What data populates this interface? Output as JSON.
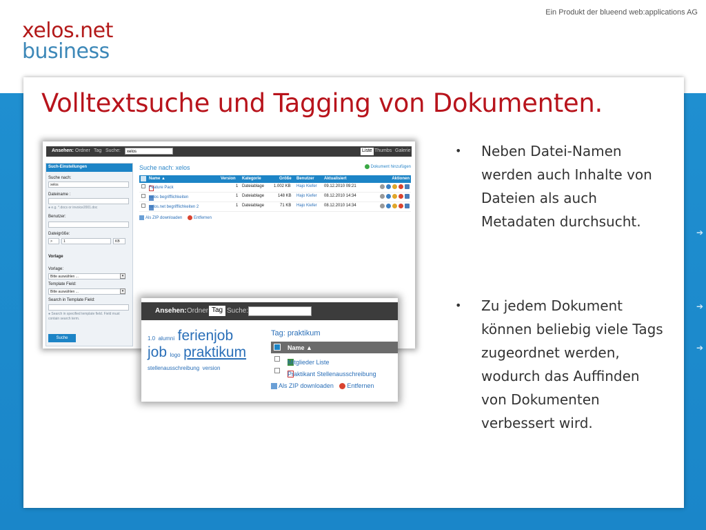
{
  "slide": {
    "tagline": "Ein Produkt der blueend web:applications AG",
    "logo_line1": "xelos.net",
    "logo_line2": "business",
    "title": "Volltextsuche und Tagging von Dokumenten.",
    "bullets": [
      "Neben Datei-Namen werden auch Inhalte von Dateien als auch Metadaten durchsucht.",
      "Zu jedem Dokument können beliebig viele Tags zugeordnet werden, wodurch das Auffinden von Dokumenten verbessert wird."
    ],
    "nav_arrow": "➔"
  },
  "shot1": {
    "toolbar": {
      "view_label": "Ansehen:",
      "folder": "Ordner",
      "tag": "Tag",
      "search_label": "Suche:",
      "search_value": "xelos",
      "list": "Liste",
      "thumbs": "Thumbs",
      "gallery": "Galerie"
    },
    "sidebar": {
      "header": "Such-Einstellungen",
      "search_for_label": "Suche nach:",
      "search_for_value": "xelos",
      "filename_label": "Dateiname :",
      "filename_hint": "e.g. *.docs or invoice2001.doc",
      "user_label": "Benutzer:",
      "filesize_label": "Dateigröße:",
      "filesize_op": ">",
      "filesize_value": "1",
      "filesize_unit": "KB",
      "template_header": "Vorlage",
      "template_label": "Vorlage:",
      "template_value": "Bitte auswählen ...",
      "template_field_label": "Template Field:",
      "template_field_value": "Bitte auswählen ...",
      "search_tf_label": "Search in Template Field:",
      "search_tf_hint": "Search in specified template field. Field must contain search term.",
      "search_button": "Suche"
    },
    "main": {
      "title": "Suche nach: xelos",
      "add_doc": "Dokument hinzufügen",
      "headers": [
        "Name ▲",
        "Version",
        "Kategorie",
        "Größe",
        "Benutzer",
        "Aktualisiert",
        "Aktionen"
      ],
      "rows": [
        {
          "type": "pdf",
          "name": "Feature Pack",
          "version": "1",
          "category": "Dateiablage",
          "size": "1.002 KB",
          "user": "Hajo Kiefer",
          "updated": "09.12.2010 09:21"
        },
        {
          "type": "doc",
          "name": "xelos begrifflichkeiten",
          "version": "1",
          "category": "Dateiablage",
          "size": "148 KB",
          "user": "Hajo Kiefer",
          "updated": "08.12.2010 14:34"
        },
        {
          "type": "doc",
          "name": "xelos.net begrifflichkeiten 2",
          "version": "1",
          "category": "Dateiablage",
          "size": "71 KB",
          "user": "Hajo Kiefer",
          "updated": "08.12.2010 14:34"
        }
      ],
      "zip": "Als ZIP downloaden",
      "remove": "Entfernen"
    }
  },
  "shot2": {
    "toolbar": {
      "view_label": "Ansehen:",
      "folder": "Ordner",
      "tag": "Tag",
      "search_label": "Suche:"
    },
    "cloud": {
      "w1": "1.0",
      "w2": "alumni",
      "w3": "ferienjob",
      "w4": "job",
      "w5": "logo",
      "w6": "praktikum",
      "w7": "stellenausschreibung",
      "w8": "version"
    },
    "title": "Tag: praktikum",
    "header_name": "Name ▲",
    "rows": [
      {
        "type": "xls",
        "name": "Mitglieder Liste"
      },
      {
        "type": "pdf",
        "name": "Praktikant Stellenausschreibung"
      }
    ],
    "zip": "Als ZIP downloaden",
    "remove": "Entfernen"
  },
  "colors": {
    "title_red": "#b8141c",
    "brand_blue": "#1c84c6",
    "link_blue": "#2a6fb8"
  }
}
